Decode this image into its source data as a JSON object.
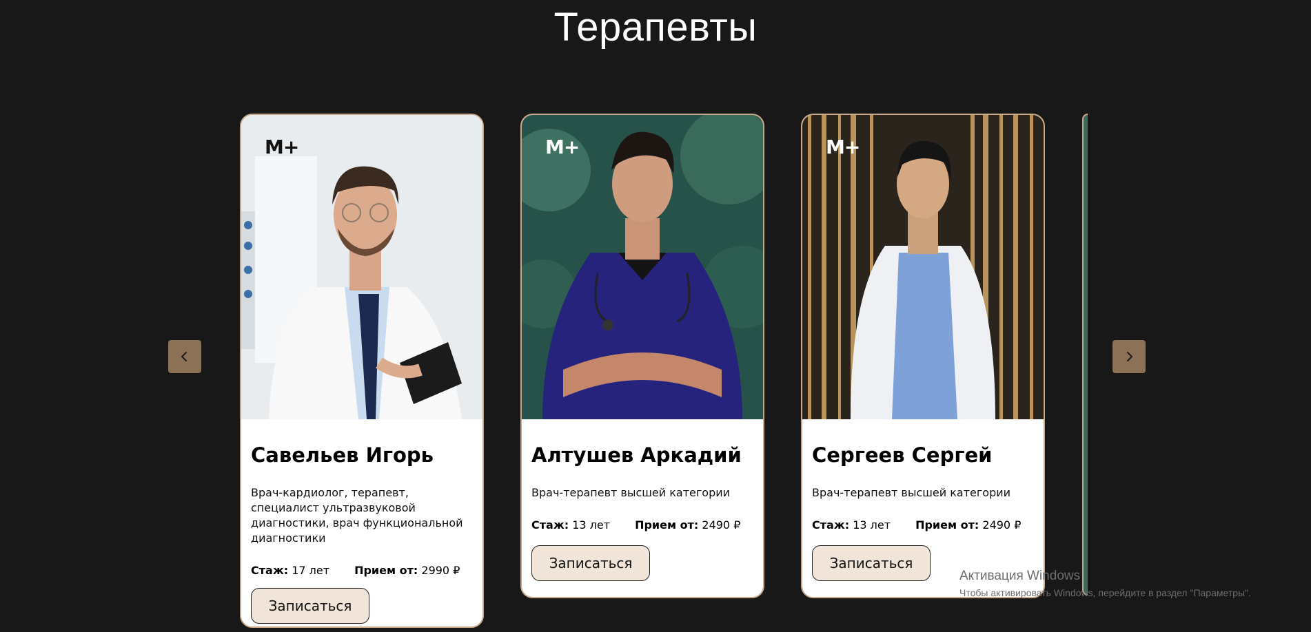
{
  "section": {
    "title": "Терапевты"
  },
  "carousel": {
    "prev_icon": "chevron-left-icon",
    "next_icon": "chevron-right-icon",
    "accent": "#8c7157"
  },
  "brand": {
    "logo": "M+"
  },
  "doctors": [
    {
      "name": "Савельев Игорь",
      "specialty": "Врач-кардиолог, терапевт, специалист ультразвуковой диагностики, врач функциональной диагностики",
      "experience_label": "Стаж:",
      "experience": "17 лет",
      "price_label": "Прием от:",
      "price": "2990 ₽",
      "button": "Записаться"
    },
    {
      "name": "Алтушев Аркадий",
      "specialty": "Врач-терапевт высшей категории",
      "experience_label": "Стаж:",
      "experience": "13 лет",
      "price_label": "Прием от:",
      "price": "2490 ₽",
      "button": "Записаться"
    },
    {
      "name": "Сергеев Сергей",
      "specialty": "Врач-терапевт высшей категории",
      "experience_label": "Стаж:",
      "experience": "13 лет",
      "price_label": "Прием от:",
      "price": "2490 ₽",
      "button": "Записаться"
    }
  ],
  "watermark": {
    "line1": "Активация Windows",
    "line2": "Чтобы активировать Windows, перейдите в раздел \"Параметры\"."
  }
}
